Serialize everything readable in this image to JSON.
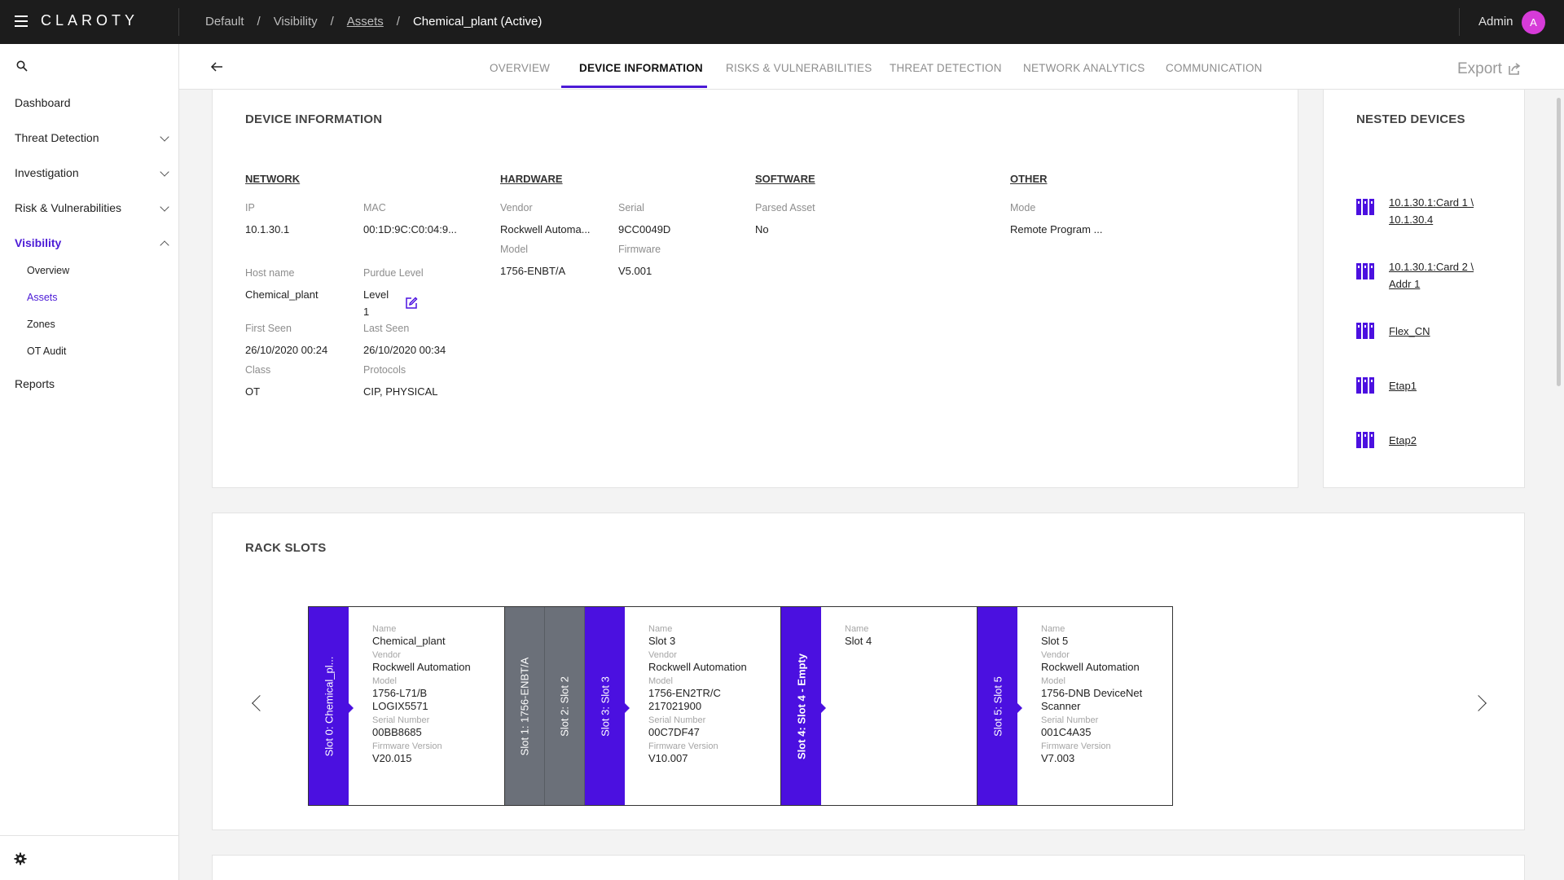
{
  "topbar": {
    "logo": "CLAROTY",
    "breadcrumb": [
      "Default",
      "Visibility",
      "Assets",
      "Chemical_plant (Active)"
    ],
    "breadcrumb_sep": "/",
    "user": "Admin",
    "avatar_initial": "A"
  },
  "sidebar": {
    "items": [
      {
        "label": "Dashboard"
      },
      {
        "label": "Threat Detection"
      },
      {
        "label": "Investigation"
      },
      {
        "label": "Risk & Vulnerabilities"
      },
      {
        "label": "Visibility"
      },
      {
        "label": "Reports"
      }
    ],
    "sub_items": [
      "Overview",
      "Assets",
      "Zones",
      "OT Audit"
    ]
  },
  "tabs": [
    "OVERVIEW",
    "DEVICE INFORMATION",
    "RISKS & VULNERABILITIES",
    "THREAT DETECTION",
    "NETWORK ANALYTICS",
    "COMMUNICATION"
  ],
  "export_label": "Export",
  "device_info": {
    "title": "DEVICE INFORMATION",
    "network": {
      "heading": "NETWORK",
      "ip_label": "IP",
      "ip": "10.1.30.1",
      "mac_label": "MAC",
      "mac": "00:1D:9C:C0:04:9...",
      "hostname_label": "Host name",
      "hostname": "Chemical_plant",
      "purdue_label": "Purdue Level",
      "purdue_line1": "Level",
      "purdue_line2": "1",
      "first_seen_label": "First Seen",
      "first_seen": "26/10/2020 00:24",
      "last_seen_label": "Last Seen",
      "last_seen": "26/10/2020 00:34",
      "class_label": "Class",
      "class": "OT",
      "protocols_label": "Protocols",
      "protocols": "CIP, PHYSICAL"
    },
    "hardware": {
      "heading": "HARDWARE",
      "vendor_label": "Vendor",
      "vendor": "Rockwell Automa...",
      "serial_label": "Serial",
      "serial": "9CC0049D",
      "model_label": "Model",
      "model": "1756-ENBT/A",
      "firmware_label": "Firmware",
      "firmware": "V5.001"
    },
    "software": {
      "heading": "SOFTWARE",
      "parsed_label": "Parsed Asset",
      "parsed": "No"
    },
    "other": {
      "heading": "OTHER",
      "mode_label": "Mode",
      "mode": "Remote Program ..."
    }
  },
  "nested_devices": {
    "title": "NESTED DEVICES",
    "items": [
      {
        "line1": "10.1.30.1:Card 1 \\",
        "line2": "10.1.30.4"
      },
      {
        "line1": "10.1.30.1:Card 2 \\",
        "line2": "Addr 1"
      },
      {
        "line1": "Flex_CN",
        "line2": ""
      },
      {
        "line1": "Etap1",
        "line2": ""
      },
      {
        "line1": "Etap2",
        "line2": ""
      }
    ]
  },
  "rack": {
    "title": "RACK SLOTS",
    "field_labels": {
      "name": "Name",
      "vendor": "Vendor",
      "model": "Model",
      "serial": "Serial Number",
      "firmware": "Firmware Version"
    },
    "tabs": [
      "Slot 0: Chemical_pl...",
      "Slot 1: 1756-ENBT/A",
      "Slot 2: Slot 2",
      "Slot 3: Slot 3",
      "Slot 4: Slot 4 - Empty",
      "Slot 5: Slot 5"
    ],
    "details": [
      {
        "name": "Chemical_plant",
        "vendor": "Rockwell Automation",
        "model1": "1756-L71/B",
        "model2": "LOGIX5571",
        "serial": "00BB8685",
        "firmware": "V20.015"
      },
      {
        "name": "Slot 3",
        "vendor": "Rockwell Automation",
        "model1": "1756-EN2TR/C",
        "model2": "217021900",
        "serial": "00C7DF47",
        "firmware": "V10.007"
      },
      {
        "name": "Slot 4"
      },
      {
        "name": "Slot 5",
        "vendor": "Rockwell Automation",
        "model1": "1756-DNB DeviceNet",
        "model2": "Scanner",
        "serial": "001C4A35",
        "firmware": "V7.003"
      }
    ]
  },
  "colors": {
    "accent": "#4b10e0",
    "slot_gray": "#6b7079",
    "topbar": "#1c1c1c"
  }
}
